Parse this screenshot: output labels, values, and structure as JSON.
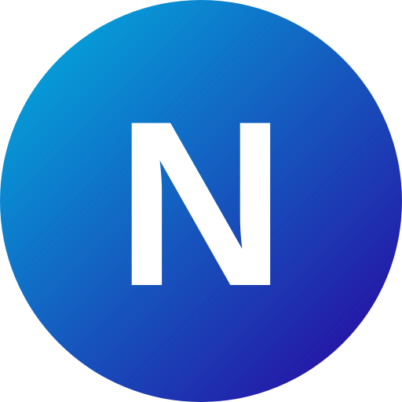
{
  "icon": {
    "letter": "N",
    "gradient_start": "#00b4e0",
    "gradient_end": "#2a009e",
    "letter_color": "#ffffff",
    "shape": "circle-badge"
  }
}
